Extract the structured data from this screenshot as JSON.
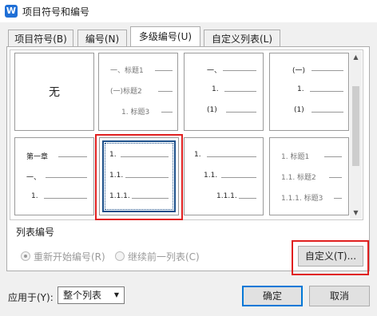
{
  "window": {
    "title": "项目符号和编号",
    "app_icon": "W"
  },
  "tabs": [
    {
      "label": "项目符号(B)",
      "active": false
    },
    {
      "label": "编号(N)",
      "active": false
    },
    {
      "label": "多级编号(U)",
      "active": true
    },
    {
      "label": "自定义列表(L)",
      "active": false
    }
  ],
  "tiles": {
    "none": "无",
    "t2": [
      "一、标题1",
      "(一)标题2",
      "1. 标题3"
    ],
    "t3": [
      "一、",
      "1.",
      "(1)"
    ],
    "t4": [
      "(一)",
      "1.",
      "(1)"
    ],
    "t5": [
      "第一章",
      "一、",
      "1."
    ],
    "t6": [
      "1.",
      "1.1.",
      "1.1.1."
    ],
    "t7": [
      "1.",
      "1.1.",
      "1.1.1."
    ],
    "t8": [
      "1. 标题1",
      "1.1. 标题2",
      "1.1.1. 标题3"
    ]
  },
  "list_numbering": {
    "label": "列表编号",
    "restart": "重新开始编号(R)",
    "continue": "继续前一列表(C)",
    "customize": "自定义(T)..."
  },
  "footer": {
    "apply_to_label": "应用于(Y):",
    "apply_to_value": "整个列表",
    "ok": "确定",
    "cancel": "取消"
  },
  "colors": {
    "highlight": "#e02020",
    "selection": "#1b4f8a"
  }
}
